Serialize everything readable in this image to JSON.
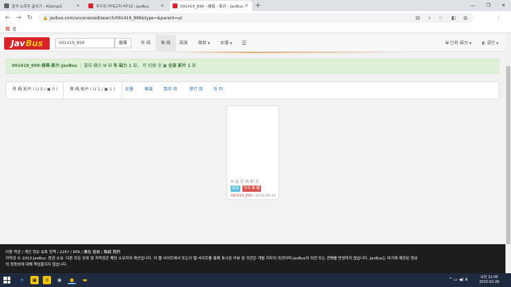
{
  "browser": {
    "tabs": [
      {
        "title": "중국 노하우 글쓰기 - ASking소",
        "favicon_color": "#5f6368",
        "active": false
      },
      {
        "title": "무수정 카테고리-비디오 -JavBus",
        "favicon_color": "#d8232a",
        "active": false
      },
      {
        "title": "091419_899 - 搜尋 - 影片 - JavBus",
        "favicon_color": "#d8232a",
        "active": true
      }
    ],
    "new_tab": "+",
    "url": "javbus.com/uncensored/search/091419_899&type=&parent=uc",
    "bookmarks_label": "앱",
    "window_controls": [
      "—",
      "❐",
      "✕"
    ]
  },
  "site": {
    "logo_part1": "Jav",
    "logo_part2": "Bus",
    "search_value": "091419_899",
    "search_button": "搜尋",
    "nav": {
      "item1": "有 碼",
      "item2": "無 碼",
      "item3": "歐美",
      "item4": "類目",
      "item5": "女優",
      "menu": "☰",
      "right1": "已有 磁力",
      "right1_prefix": "U",
      "right2": "语언",
      "right2_prefix": "◐"
    },
    "alert": {
      "title": "091419_899-搜尋-影片-JavBus",
      "sep": "｜",
      "text1": "當前 顯示",
      "icon1": "U",
      "text2": "部",
      "bold": "有 磁力 1",
      "text3": "部， 可 切換 至",
      "icon2": "▣",
      "bold2": "全部 影片 1",
      "text4": "部"
    },
    "filters": {
      "f1": "有 碼 影片 ( U 0 / ▣ 0 )",
      "f2": "無 碼 影片 ( U 1 / ▣ 1 )",
      "f3": "女優",
      "f4": "導演",
      "f5": "製作 商",
      "f6": "發行 商",
      "f7": "系 列"
    },
    "movie": {
      "title": "M 指 女 桃 桐 光",
      "badge_hd": "高清",
      "badge_sub": "今日 新 種",
      "code": "091419_899",
      "sep": "/",
      "date": "2019-09-14"
    },
    "footer": {
      "line1": "이용 약관 / 개인 정보 보호 정책 / 2257 / RTA / 廣告 投放 / 聯絡 我們",
      "line2": "저작권 © 2013 JavBus. 판권 소유. 다른 모든 상표 및 저작권은 해당 소유자의 재산입니다. 이 웹 사이트에서 또는이 웹 사이트를 통해 표시된 리뷰 및 의견은 개별 저자의 의견이며 JavBus의 의견 또는 견해를 반영하지 않습니다. JavBus는 여기에 제공된 정보",
      "line3": "의 정확성에 대해 책임을지지 않습니다."
    }
  },
  "taskbar": {
    "icons": [
      "e",
      "▣",
      "d",
      "◉",
      "●",
      "▬"
    ],
    "time": "오전 11:06",
    "date": "2020-02-26",
    "tray": "^ ▭ ◀) A"
  }
}
